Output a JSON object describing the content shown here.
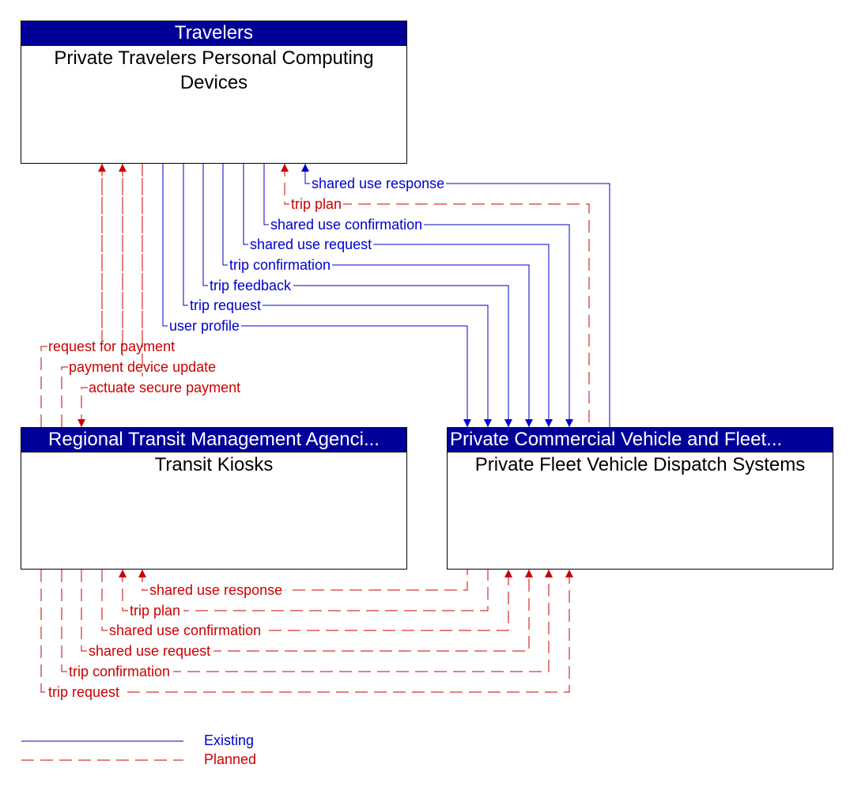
{
  "colors": {
    "existing": "#0000cc",
    "planned": "#cc0000",
    "header_bg": "#000099"
  },
  "nodes": {
    "travelers": {
      "header": "Travelers",
      "title": "Private Travelers Personal Computing Devices"
    },
    "kiosks": {
      "header": "Regional Transit Management Agenci...",
      "title": "Transit Kiosks"
    },
    "fleet": {
      "header": "Private Commercial Vehicle and Fleet...",
      "title": "Private Fleet Vehicle Dispatch Systems"
    }
  },
  "flows_travelers_fleet": [
    {
      "label": "shared use response",
      "status": "existing",
      "direction": "to-travelers"
    },
    {
      "label": "trip plan",
      "status": "planned",
      "direction": "to-travelers"
    },
    {
      "label": "shared use confirmation",
      "status": "existing",
      "direction": "to-fleet"
    },
    {
      "label": "shared use request",
      "status": "existing",
      "direction": "to-fleet"
    },
    {
      "label": "trip confirmation",
      "status": "existing",
      "direction": "to-fleet"
    },
    {
      "label": "trip feedback",
      "status": "existing",
      "direction": "to-fleet"
    },
    {
      "label": "trip request",
      "status": "existing",
      "direction": "to-fleet"
    },
    {
      "label": "user profile",
      "status": "existing",
      "direction": "to-fleet"
    }
  ],
  "flows_travelers_kiosks": [
    {
      "label": "request for payment",
      "status": "planned",
      "direction": "to-travelers"
    },
    {
      "label": "payment device update",
      "status": "planned",
      "direction": "to-travelers"
    },
    {
      "label": "actuate secure payment",
      "status": "planned",
      "direction": "to-kiosks"
    }
  ],
  "flows_kiosks_fleet": [
    {
      "label": "shared use response",
      "status": "planned",
      "direction": "to-kiosks"
    },
    {
      "label": "trip plan",
      "status": "planned",
      "direction": "to-kiosks"
    },
    {
      "label": "shared use confirmation",
      "status": "planned",
      "direction": "to-fleet"
    },
    {
      "label": "shared use request",
      "status": "planned",
      "direction": "to-fleet"
    },
    {
      "label": "trip confirmation",
      "status": "planned",
      "direction": "to-fleet"
    },
    {
      "label": "trip request",
      "status": "planned",
      "direction": "to-fleet"
    }
  ],
  "legend": {
    "existing": "Existing",
    "planned": "Planned"
  }
}
